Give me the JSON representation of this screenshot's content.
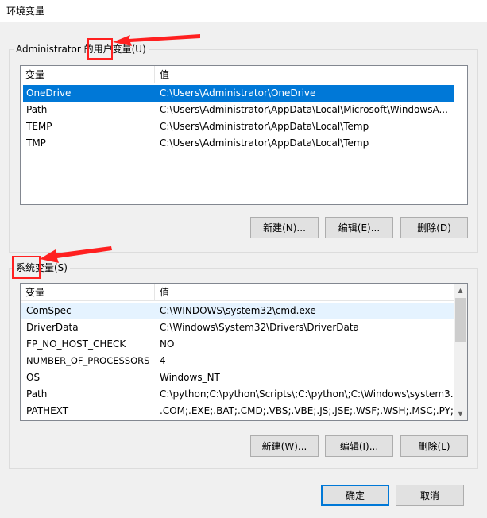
{
  "window": {
    "title": "环境变量"
  },
  "user_vars": {
    "group_label": "Administrator 的用户变量(U)",
    "columns": [
      "变量",
      "值"
    ],
    "rows": [
      {
        "name": "OneDrive",
        "value": "C:\\Users\\Administrator\\OneDrive"
      },
      {
        "name": "Path",
        "value": "C:\\Users\\Administrator\\AppData\\Local\\Microsoft\\WindowsA..."
      },
      {
        "name": "TEMP",
        "value": "C:\\Users\\Administrator\\AppData\\Local\\Temp"
      },
      {
        "name": "TMP",
        "value": "C:\\Users\\Administrator\\AppData\\Local\\Temp"
      }
    ],
    "buttons": {
      "new": "新建(N)...",
      "edit": "编辑(E)...",
      "delete": "删除(D)"
    }
  },
  "system_vars": {
    "group_label": "系统变量(S)",
    "columns": [
      "变量",
      "值"
    ],
    "rows": [
      {
        "name": "ComSpec",
        "value": "C:\\WINDOWS\\system32\\cmd.exe"
      },
      {
        "name": "DriverData",
        "value": "C:\\Windows\\System32\\Drivers\\DriverData"
      },
      {
        "name": "FP_NO_HOST_CHECK",
        "value": "NO"
      },
      {
        "name": "NUMBER_OF_PROCESSORS",
        "value": "4"
      },
      {
        "name": "OS",
        "value": "Windows_NT"
      },
      {
        "name": "Path",
        "value": "C:\\python;C:\\python\\Scripts\\;C:\\python\\;C:\\Windows\\system3..."
      },
      {
        "name": "PATHEXT",
        "value": ".COM;.EXE;.BAT;.CMD;.VBS;.VBE;.JS;.JSE;.WSF;.WSH;.MSC;.PY;.P..."
      }
    ],
    "buttons": {
      "new": "新建(W)...",
      "edit": "编辑(I)...",
      "delete": "删除(L)"
    }
  },
  "footer": {
    "ok": "确定",
    "cancel": "取消"
  },
  "colors": {
    "selection": "#0078d7",
    "annotation": "#ff2020"
  }
}
